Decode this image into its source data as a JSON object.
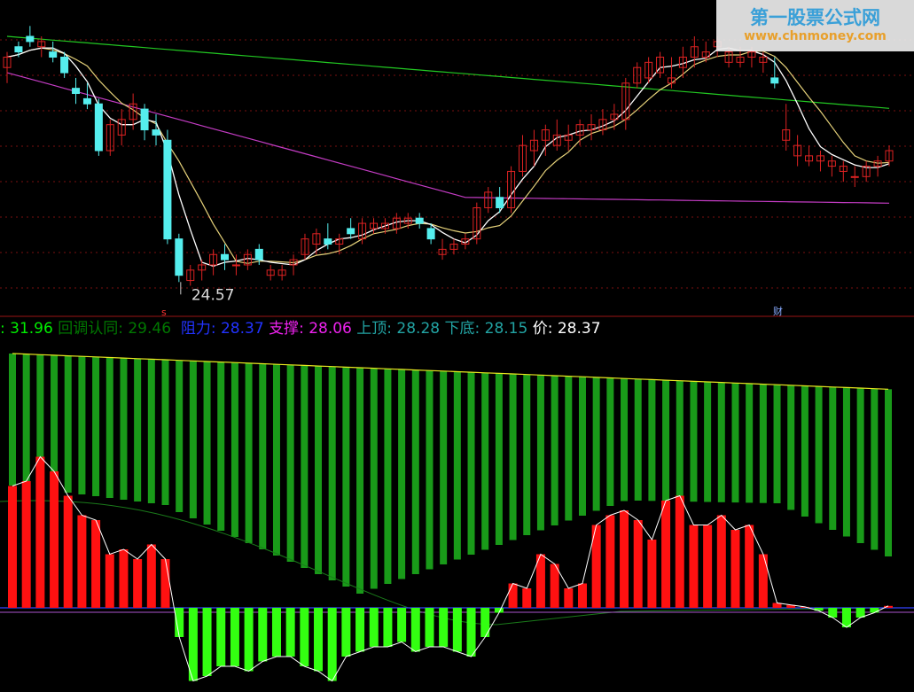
{
  "watermark": {
    "title": "第一股票公式网",
    "url": "www.chnmoney.com"
  },
  "upper": {
    "low_label": "24.57",
    "marker_s": "s",
    "marker_cai": "财",
    "candles": [
      [
        28.7,
        29.0,
        28.4,
        28.9
      ],
      [
        29.1,
        29.2,
        28.9,
        29.0
      ],
      [
        29.3,
        29.5,
        29.1,
        29.2
      ],
      [
        29.1,
        29.3,
        28.9,
        29.2
      ],
      [
        29.0,
        29.2,
        28.8,
        28.9
      ],
      [
        28.9,
        29.0,
        28.5,
        28.6
      ],
      [
        28.3,
        28.5,
        28.0,
        28.2
      ],
      [
        28.1,
        28.4,
        27.9,
        28.0
      ],
      [
        28.0,
        28.1,
        27.0,
        27.1
      ],
      [
        27.1,
        27.7,
        27.0,
        27.6
      ],
      [
        27.4,
        27.9,
        27.2,
        27.7
      ],
      [
        27.7,
        28.2,
        27.5,
        28.0
      ],
      [
        27.9,
        28.0,
        27.3,
        27.5
      ],
      [
        27.5,
        27.8,
        27.2,
        27.4
      ],
      [
        27.3,
        27.5,
        25.3,
        25.4
      ],
      [
        25.4,
        25.5,
        24.57,
        24.7
      ],
      [
        24.6,
        24.9,
        24.5,
        24.8
      ],
      [
        24.8,
        25.0,
        24.6,
        24.9
      ],
      [
        24.9,
        25.2,
        24.7,
        25.1
      ],
      [
        25.1,
        25.3,
        24.8,
        25.0
      ],
      [
        24.9,
        25.1,
        24.7,
        24.9
      ],
      [
        24.9,
        25.2,
        24.8,
        25.1
      ],
      [
        25.2,
        25.3,
        24.9,
        25.0
      ],
      [
        24.7,
        24.9,
        24.6,
        24.8
      ],
      [
        24.7,
        24.9,
        24.6,
        24.8
      ],
      [
        24.9,
        25.1,
        24.7,
        25.0
      ],
      [
        25.1,
        25.5,
        25.0,
        25.4
      ],
      [
        25.3,
        25.6,
        25.1,
        25.5
      ],
      [
        25.4,
        25.7,
        25.2,
        25.3
      ],
      [
        25.3,
        25.5,
        25.1,
        25.4
      ],
      [
        25.6,
        25.8,
        25.4,
        25.5
      ],
      [
        25.4,
        25.8,
        25.3,
        25.7
      ],
      [
        25.6,
        25.8,
        25.5,
        25.7
      ],
      [
        25.6,
        25.8,
        25.5,
        25.7
      ],
      [
        25.6,
        25.9,
        25.5,
        25.8
      ],
      [
        25.7,
        25.9,
        25.6,
        25.8
      ],
      [
        25.8,
        25.9,
        25.6,
        25.7
      ],
      [
        25.6,
        25.7,
        25.3,
        25.4
      ],
      [
        25.1,
        25.4,
        25.0,
        25.2
      ],
      [
        25.2,
        25.4,
        25.1,
        25.3
      ],
      [
        25.3,
        25.5,
        25.2,
        25.4
      ],
      [
        25.4,
        26.1,
        25.3,
        26.0
      ],
      [
        26.0,
        26.4,
        25.9,
        26.3
      ],
      [
        26.2,
        26.4,
        25.9,
        26.0
      ],
      [
        26.0,
        26.8,
        25.9,
        26.7
      ],
      [
        26.7,
        27.4,
        26.6,
        27.2
      ],
      [
        27.1,
        27.5,
        26.8,
        27.3
      ],
      [
        27.3,
        27.6,
        27.0,
        27.5
      ],
      [
        27.2,
        27.7,
        27.1,
        27.4
      ],
      [
        27.3,
        27.6,
        27.1,
        27.4
      ],
      [
        27.4,
        27.7,
        27.2,
        27.6
      ],
      [
        27.5,
        27.8,
        27.3,
        27.6
      ],
      [
        27.5,
        27.9,
        27.4,
        27.7
      ],
      [
        27.7,
        28.0,
        27.5,
        27.8
      ],
      [
        27.7,
        28.5,
        27.5,
        28.4
      ],
      [
        28.4,
        28.8,
        28.3,
        28.7
      ],
      [
        28.5,
        28.9,
        28.4,
        28.8
      ],
      [
        28.6,
        29.0,
        28.5,
        28.9
      ],
      [
        28.4,
        28.9,
        28.3,
        28.5
      ],
      [
        28.7,
        29.1,
        28.5,
        28.9
      ],
      [
        28.9,
        29.3,
        28.7,
        29.1
      ],
      [
        28.9,
        29.2,
        28.8,
        29.0
      ],
      [
        29.1,
        29.3,
        28.9,
        29.2
      ],
      [
        28.8,
        29.1,
        28.7,
        29.0
      ],
      [
        28.8,
        29.1,
        28.7,
        28.9
      ],
      [
        28.9,
        29.1,
        28.7,
        29.0
      ],
      [
        28.8,
        29.0,
        28.6,
        28.9
      ],
      [
        28.5,
        28.9,
        28.3,
        28.4
      ],
      [
        27.3,
        28.0,
        27.1,
        27.5
      ],
      [
        27.0,
        27.4,
        26.8,
        27.2
      ],
      [
        26.9,
        27.2,
        26.8,
        27.0
      ],
      [
        26.9,
        27.1,
        26.7,
        27.0
      ],
      [
        26.8,
        27.0,
        26.6,
        26.9
      ],
      [
        26.7,
        26.9,
        26.5,
        26.8
      ],
      [
        26.6,
        26.8,
        26.4,
        26.6
      ],
      [
        26.6,
        26.9,
        26.5,
        26.8
      ],
      [
        26.8,
        27.0,
        26.6,
        26.9
      ],
      [
        26.9,
        27.2,
        26.8,
        27.1
      ]
    ]
  },
  "indicator": {
    "labels": [
      {
        "name": "",
        "value": "31.96",
        "name_color": "#00ee00",
        "value_color": "#00ee00"
      },
      {
        "name": "回调认同",
        "value": "29.46",
        "name_color": "#007700",
        "value_color": "#007700"
      },
      {
        "name": "阻力",
        "value": "28.37",
        "name_color": "#2233ff",
        "value_color": "#2233ff"
      },
      {
        "name": "支撑",
        "value": "28.06",
        "name_color": "#ee22ee",
        "value_color": "#ee22ee"
      },
      {
        "name": "上顶",
        "value": "28.28",
        "name_color": "#22a3a3",
        "value_color": "#22a3a3"
      },
      {
        "name": "下底",
        "value": "28.15",
        "name_color": "#22a3a3",
        "value_color": "#22a3a3"
      },
      {
        "name": "价",
        "value": "28.37",
        "name_color": "#ffffff",
        "value_color": "#ffffff"
      }
    ],
    "histogram": [
      1.25,
      1.3,
      1.55,
      1.4,
      1.15,
      0.95,
      0.9,
      0.55,
      0.6,
      0.5,
      0.65,
      0.5,
      -0.3,
      -0.75,
      -0.7,
      -0.6,
      -0.6,
      -0.65,
      -0.55,
      -0.5,
      -0.5,
      -0.6,
      -0.65,
      -0.75,
      -0.5,
      -0.45,
      -0.4,
      -0.4,
      -0.35,
      -0.45,
      -0.4,
      -0.4,
      -0.45,
      -0.5,
      -0.3,
      -0.05,
      0.25,
      0.2,
      0.55,
      0.45,
      0.2,
      0.25,
      0.85,
      0.95,
      1.0,
      0.9,
      0.7,
      1.1,
      1.15,
      0.85,
      0.85,
      0.95,
      0.8,
      0.85,
      0.55,
      0.05,
      0.03,
      0.01,
      -0.03,
      -0.1,
      -0.2,
      -0.1,
      -0.05,
      0.02
    ]
  },
  "colors": {
    "bg": "#000000",
    "up": "#dd2222",
    "down": "#55eeee",
    "ma_white": "#ffffff",
    "ma_yellow": "#e6d27a",
    "ma_green": "#22c822",
    "ma_purple": "#c43cc4",
    "hist_pos": "#ff1111",
    "hist_neg": "#33ff11",
    "bars_green": "#199a19"
  }
}
